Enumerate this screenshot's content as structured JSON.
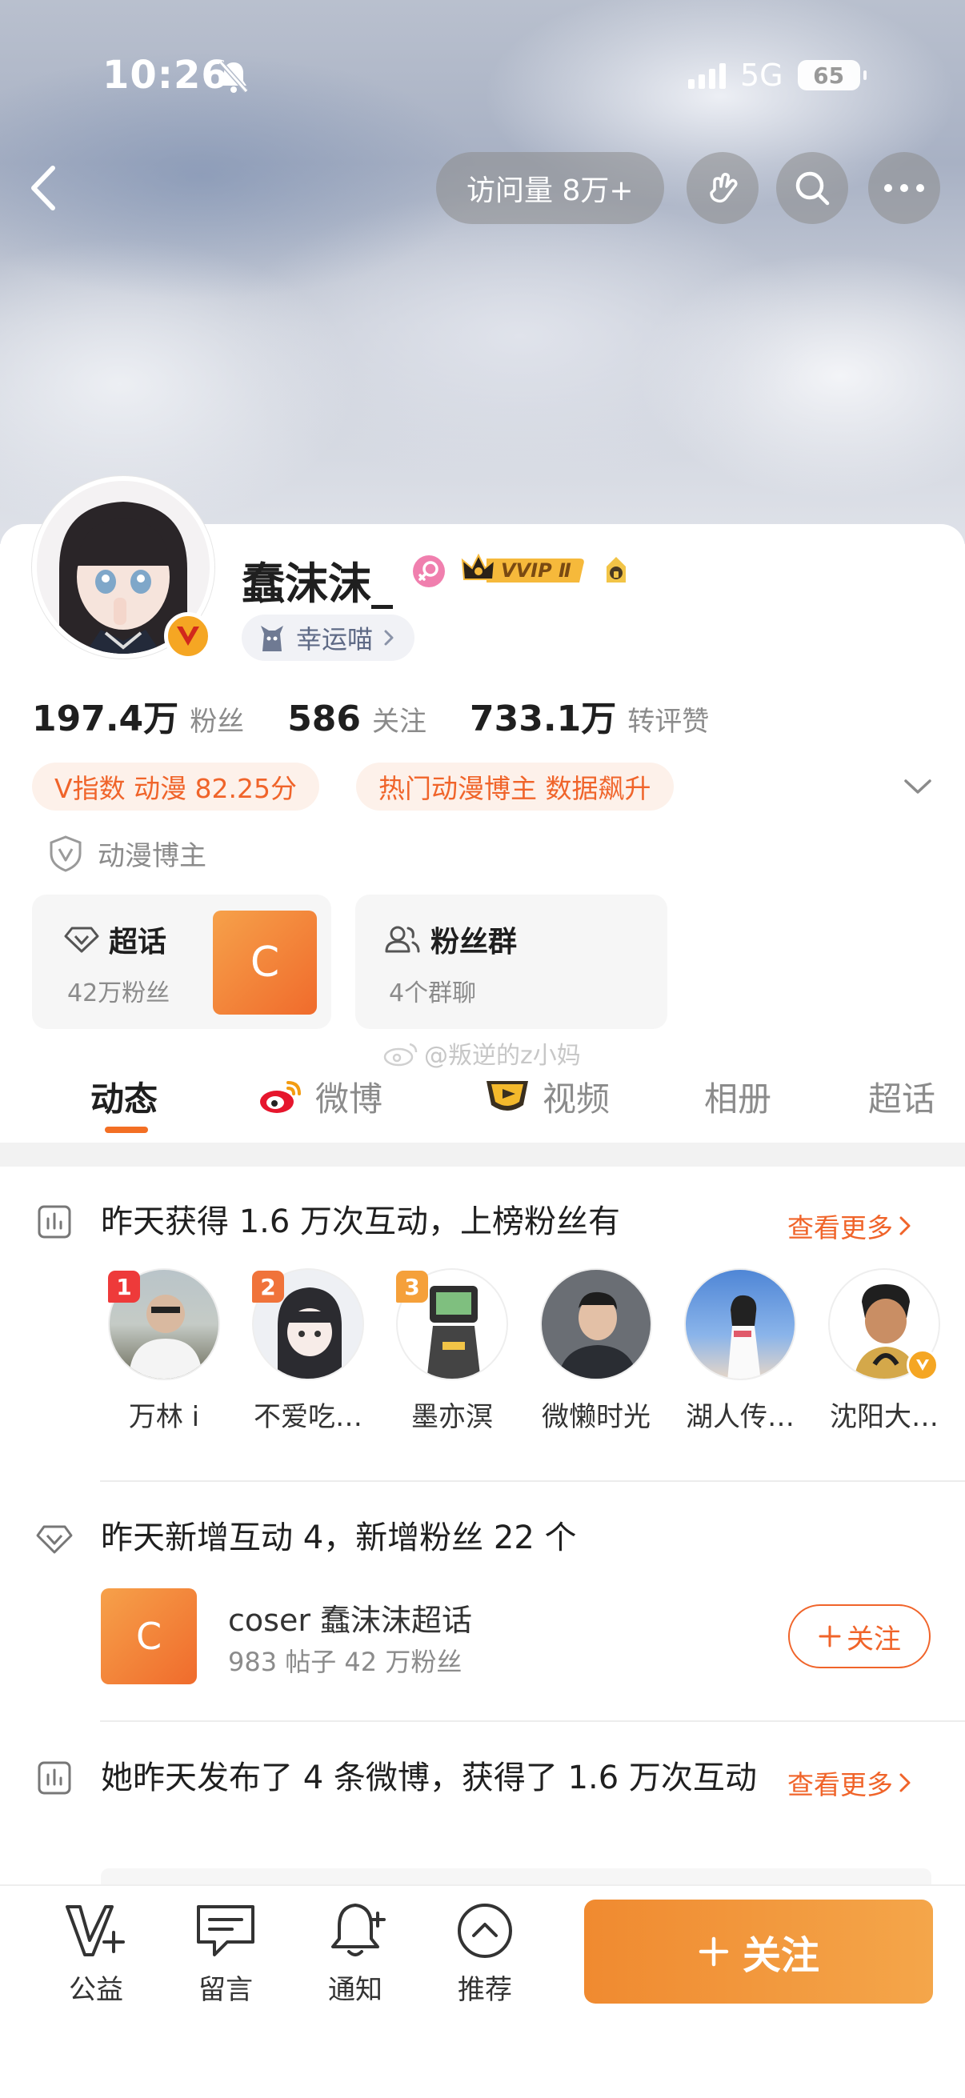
{
  "status_bar": {
    "time": "10:26",
    "network": "5G",
    "battery": "65"
  },
  "header": {
    "visit_label": "访问量 8万+"
  },
  "profile": {
    "username": "蠢沫沫_",
    "vvip_label": "VVIP Ⅱ",
    "lucky_label": "幸运喵",
    "stats": [
      {
        "value": "197.4万",
        "label": "粉丝"
      },
      {
        "value": "586",
        "label": "关注"
      },
      {
        "value": "733.1万",
        "label": "转评赞"
      }
    ],
    "tags": [
      "V指数 动漫 82.25分",
      "热门动漫博主 数据飙升"
    ],
    "verification": "动漫博主"
  },
  "cards": {
    "supertopic": {
      "title": "超话",
      "sub": "42万粉丝",
      "logo_letter": "C"
    },
    "fangroup": {
      "title": "粉丝群",
      "sub": "4个群聊"
    }
  },
  "watermark": "@叛逆的z小妈",
  "tabs": [
    {
      "label": "动态"
    },
    {
      "label": "微博"
    },
    {
      "label": "视频"
    },
    {
      "label": "相册"
    },
    {
      "label": "超话"
    }
  ],
  "section1": {
    "title": "昨天获得 1.6 万次互动，上榜粉丝有",
    "more": "查看更多",
    "fans": [
      {
        "name": "万林 i",
        "rank": "1"
      },
      {
        "name": "不爱吃…",
        "rank": "2"
      },
      {
        "name": "墨亦溟",
        "rank": "3"
      },
      {
        "name": "微懒时光",
        "rank": ""
      },
      {
        "name": "湖人传…",
        "rank": ""
      },
      {
        "name": "沈阳大…",
        "rank": ""
      }
    ]
  },
  "section2": {
    "title": "昨天新增互动 4，新增粉丝 22 个",
    "topic_name": "coser 蠢沫沫超话",
    "topic_sub": "983 帖子  42 万粉丝",
    "follow_label": "关注"
  },
  "section3": {
    "title": "她昨天发布了 4 条微博，获得了 1.6 万次互动",
    "more": "查看更多"
  },
  "bottom_bar": {
    "items": [
      "公益",
      "留言",
      "通知",
      "推荐"
    ],
    "follow_label": "关注"
  },
  "colors": {
    "accent": "#f0642a",
    "follow_gradient_start": "#f08a30",
    "follow_gradient_end": "#f4a64a"
  }
}
